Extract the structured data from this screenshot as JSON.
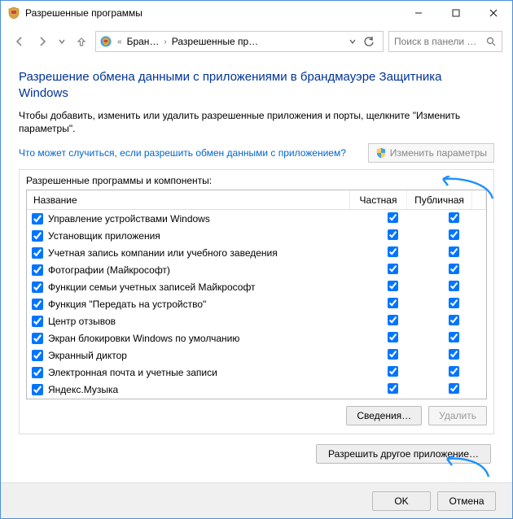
{
  "titlebar": {
    "title": "Разрешенные программы"
  },
  "breadcrumb": {
    "part1": "Бран…",
    "part2": "Разрешенные пр…"
  },
  "search": {
    "placeholder": "Поиск в панели …"
  },
  "heading": "Разрешение обмена данными с приложениями в брандмауэре Защитника Windows",
  "description": "Чтобы добавить, изменить или удалить разрешенные приложения и порты, щелкните \"Изменить параметры\".",
  "risk_link": "Что может случиться, если разрешить обмен данными с приложением?",
  "change_params": "Изменить параметры",
  "group_title": "Разрешенные программы и компоненты:",
  "columns": {
    "name": "Название",
    "private": "Частная",
    "public": "Публичная"
  },
  "rows": [
    {
      "name": "Управление устройствами Windows",
      "enabled": true,
      "private": true,
      "public": true
    },
    {
      "name": "Установщик приложения",
      "enabled": true,
      "private": true,
      "public": true
    },
    {
      "name": "Учетная запись компании или учебного заведения",
      "enabled": true,
      "private": true,
      "public": true
    },
    {
      "name": "Фотографии (Майкрософт)",
      "enabled": true,
      "private": true,
      "public": true
    },
    {
      "name": "Функции семьи учетных записей Майкрософт",
      "enabled": true,
      "private": true,
      "public": true
    },
    {
      "name": "Функция \"Передать на устройство\"",
      "enabled": true,
      "private": true,
      "public": true
    },
    {
      "name": "Центр отзывов",
      "enabled": true,
      "private": true,
      "public": true
    },
    {
      "name": "Экран блокировки Windows по умолчанию",
      "enabled": true,
      "private": true,
      "public": true
    },
    {
      "name": "Экранный диктор",
      "enabled": true,
      "private": true,
      "public": true
    },
    {
      "name": "Электронная почта и учетные записи",
      "enabled": true,
      "private": true,
      "public": true
    },
    {
      "name": "Яндекс.Музыка",
      "enabled": true,
      "private": true,
      "public": true
    }
  ],
  "buttons": {
    "details": "Сведения…",
    "delete": "Удалить",
    "allow_other": "Разрешить другое приложение…",
    "ok": "OK",
    "cancel": "Отмена"
  }
}
